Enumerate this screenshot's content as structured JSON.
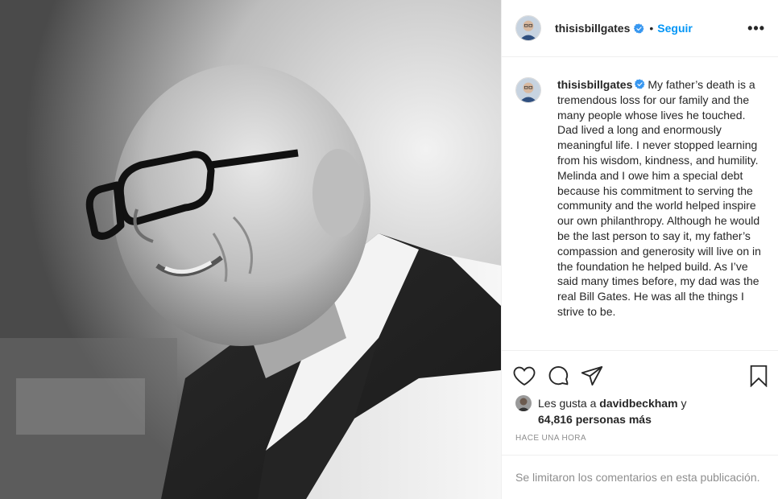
{
  "post": {
    "username": "thisisbillgates",
    "follow_label": "Seguir",
    "dot": "•",
    "more_label": "•••",
    "caption": "My father’s death is a tremendous loss for our family and the many people whose lives he touched. Dad lived a long and enormously meaningful life. I never stopped learning from his wisdom, kindness, and humility. Melinda and I owe him a special debt because his commitment to serving the community and the world helped inspire our own philanthropy. Although he would be the last person to say it, my father’s compassion and generosity will live on in the foundation he helped build. As I’ve said many times before, my dad was the real Bill Gates. He was all the things I strive to be."
  },
  "likes": {
    "prefix": "Les gusta a",
    "liker": "davidbeckham",
    "connector": "y",
    "count_text": "64,816 personas más"
  },
  "timestamp": "HACE UNA HORA",
  "comments_notice": "Se limitaron los comentarios en esta publicación.",
  "colors": {
    "link_blue": "#0095f6",
    "verified_blue": "#3897f0",
    "muted": "#8e8e8e"
  },
  "icons": [
    "heart-icon",
    "comment-icon",
    "share-icon",
    "bookmark-icon",
    "verified-badge-icon",
    "more-icon"
  ]
}
